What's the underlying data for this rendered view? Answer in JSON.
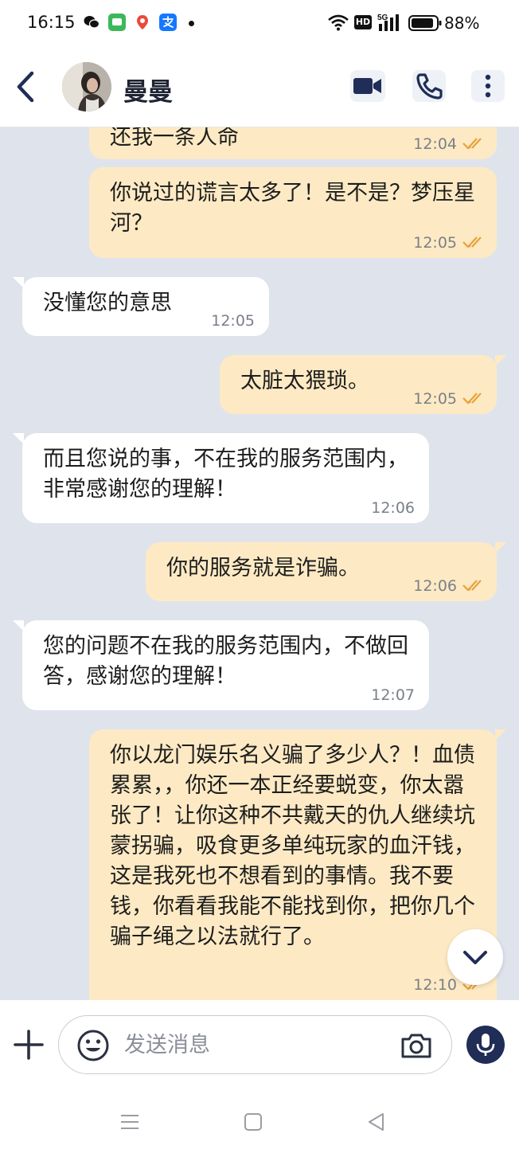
{
  "status_bar": {
    "time": "16:15",
    "battery": "88%",
    "icons": [
      "wechat-icon",
      "messages-icon",
      "maps-icon",
      "alipay-icon",
      "wifi-icon",
      "hd-icon",
      "signal-5g-icon",
      "battery-icon"
    ]
  },
  "header": {
    "contact_name": "曼曼",
    "icons": [
      "back-arrow-icon",
      "video-call-icon",
      "phone-icon",
      "more-icon"
    ]
  },
  "messages": [
    {
      "side": "out",
      "text": "还我一条人命",
      "time": "12:04",
      "read": true
    },
    {
      "side": "out",
      "text": "你说过的谎言太多了！是不是？梦压星河？",
      "time": "12:05",
      "read": true
    },
    {
      "side": "in",
      "text": "没懂您的意思",
      "time": "12:05"
    },
    {
      "side": "out",
      "text": "太脏太猥琐。",
      "time": "12:05",
      "read": true
    },
    {
      "side": "in",
      "text": "而且您说的事，不在我的服务范围内，非常感谢您的理解！",
      "time": "12:06"
    },
    {
      "side": "out",
      "text": "你的服务就是诈骗。",
      "time": "12:06",
      "read": true
    },
    {
      "side": "in",
      "text": "您的问题不在我的服务范围内，不做回答，感谢您的理解！",
      "time": "12:07"
    },
    {
      "side": "out",
      "text": "你以龙门娱乐名义骗了多少人？！血债累累，，你还一本正经要蜕变，你太嚣张了！让你这种不共戴天的仇人继续坑蒙拐骗，吸食更多单纯玩家的血汗钱，这是我死也不想看到的事情。我不要钱，你看看我能不能找到你，把你几个骗子绳之以法就行了。",
      "time": "12:10",
      "read": true
    }
  ],
  "composer": {
    "placeholder": "发送消息"
  },
  "colors": {
    "outgoing_bubble": "#fdeac4",
    "incoming_bubble": "#ffffff",
    "chat_background": "#dfe3ec",
    "accent": "#1f2d57",
    "read_ticks": "#e8a23c"
  }
}
